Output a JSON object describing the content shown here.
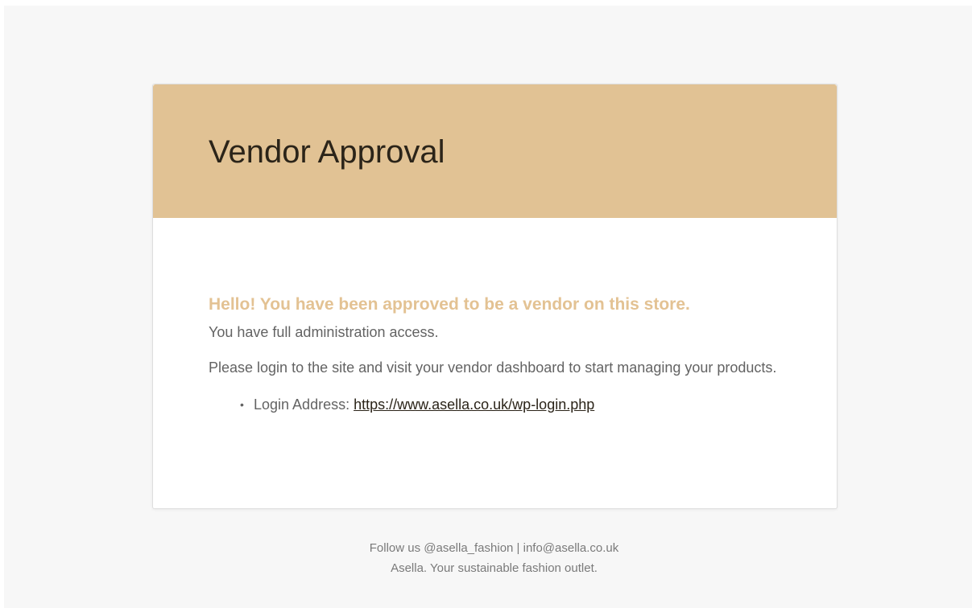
{
  "email": {
    "title": "Vendor Approval",
    "header_color": "#e1c294",
    "greeting": "Hello! You have been approved to be a vendor on this store.",
    "access_text": "You have full administration access.",
    "login_instructions": "Please login to the site and visit your vendor dashboard to start managing your products.",
    "details": [
      {
        "label": "Login Address: ",
        "link_text": "https://www.asella.co.uk/wp-login.php",
        "link_href": "https://www.asella.co.uk/wp-login.php"
      }
    ],
    "bullet_glyph": "•"
  },
  "footer": {
    "line1": "Follow us @asella_fashion | info@asella.co.uk",
    "line2": "Asella. Your sustainable fashion outlet."
  }
}
